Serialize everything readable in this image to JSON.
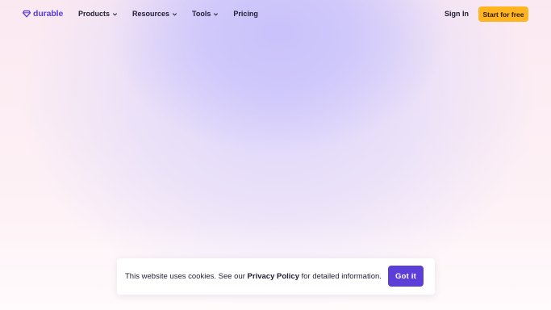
{
  "brand": {
    "name": "durable",
    "icon": "diamond-logo-icon",
    "color": "#5a3fd6"
  },
  "nav": {
    "items": [
      {
        "label": "Products",
        "has_dropdown": true
      },
      {
        "label": "Resources",
        "has_dropdown": true
      },
      {
        "label": "Tools",
        "has_dropdown": true
      },
      {
        "label": "Pricing",
        "has_dropdown": false
      }
    ]
  },
  "header": {
    "sign_in_label": "Sign In",
    "cta_label": "Start for free",
    "cta_color": "#ffb420"
  },
  "cookie_banner": {
    "text_before": "This website uses cookies. See our ",
    "link_label": "Privacy Policy",
    "text_after": " for detailed information.",
    "button_label": "Got it",
    "button_color": "#5b3fd8"
  }
}
